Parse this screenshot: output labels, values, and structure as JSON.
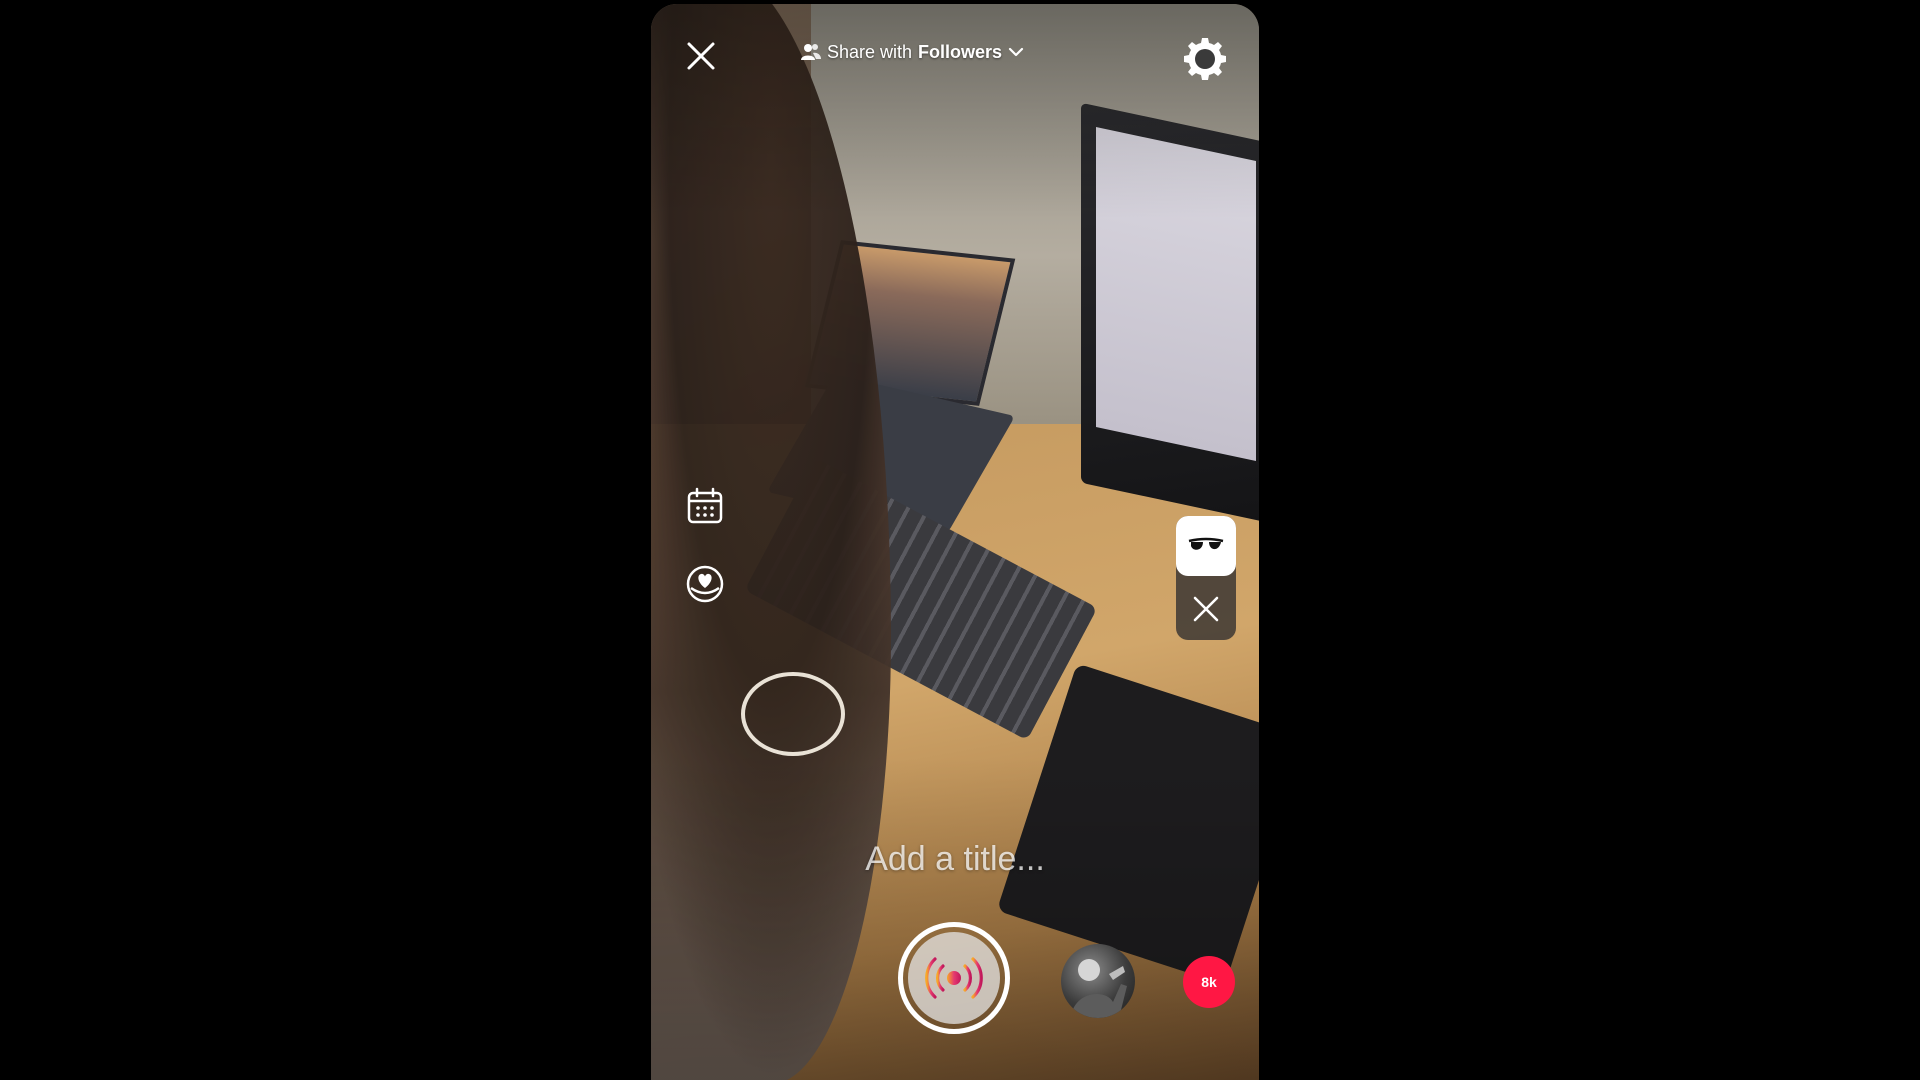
{
  "header": {
    "close_icon": "close-icon",
    "share_prefix": "Share with",
    "share_audience": "Followers",
    "settings_icon": "gear-icon"
  },
  "side_tools": [
    {
      "icon": "calendar-icon"
    },
    {
      "icon": "heart-badge-icon"
    }
  ],
  "effects": {
    "active_icon": "glasses-icon",
    "dismiss_icon": "close-icon"
  },
  "title_field": {
    "placeholder": "Add a title..."
  },
  "bottom": {
    "go_live_icon": "broadcast-icon",
    "viewer_count": "8k"
  },
  "colors": {
    "badge": "#ff1744",
    "broadcast_gradient_start": "#f7a928",
    "broadcast_gradient_end": "#c2185b"
  }
}
